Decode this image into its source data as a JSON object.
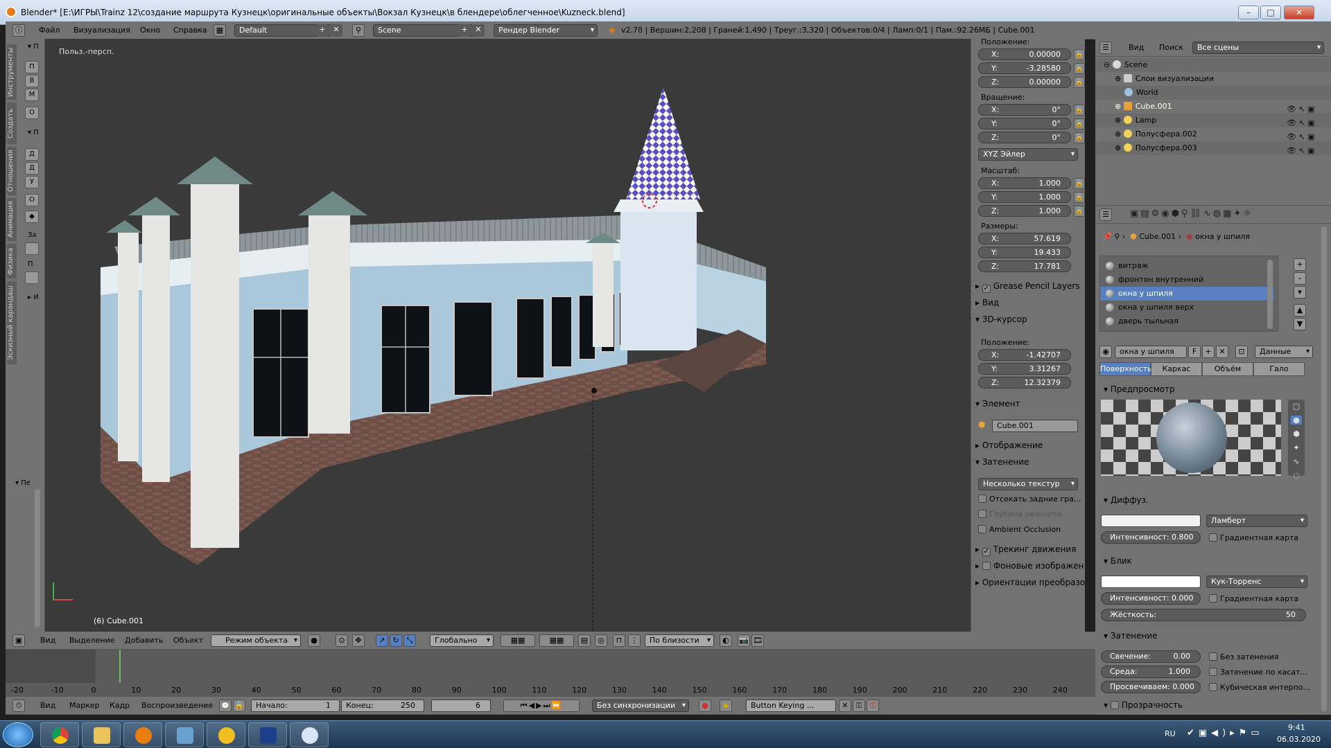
{
  "window": {
    "title": "Blender* [E:\\ИГРЫ\\Trainz 12\\создание маршрута Кузнецк\\оригинальные объекты\\Вокзал Кузнецк\\в блендере\\облегченное\\Kuzneck.blend]"
  },
  "menubar": {
    "menus": [
      "Файл",
      "Визуализация",
      "Окно",
      "Справка"
    ],
    "layout": "Default",
    "scene": "Scene",
    "engine": "Рендер Blender",
    "stats": "v2.78 | Вершин:2,208 | Граней:1,490 | Треуг.:3,320 | Объектов:0/4 | Ламп:0/1 | Пам.:92.26МБ | Cube.001"
  },
  "toolshelf": {
    "tabs": [
      "Инструменты",
      "Создать",
      "Отношения",
      "Анимация",
      "Физика",
      "Эскизный карандаш"
    ],
    "headers": [
      "▾ П",
      "▾ П",
      "▸ И",
      "▾ Пе"
    ],
    "buttons": [
      "П",
      "В",
      "М",
      "О",
      "Д",
      "Д",
      "У",
      "О",
      "За",
      "П"
    ]
  },
  "viewport": {
    "label": "Польз.-персп.",
    "object": "(6) Cube.001"
  },
  "npanel": {
    "location_label": "Положение:",
    "location": [
      {
        "axis": "X:",
        "value": "0.00000"
      },
      {
        "axis": "Y:",
        "value": "-3.28580"
      },
      {
        "axis": "Z:",
        "value": "0.00000"
      }
    ],
    "rotation_label": "Вращение:",
    "rotation": [
      {
        "axis": "X:",
        "value": "0°"
      },
      {
        "axis": "Y:",
        "value": "0°"
      },
      {
        "axis": "Z:",
        "value": "0°"
      }
    ],
    "rotation_mode": "XYZ Эйлер",
    "scale_label": "Масштаб:",
    "scale": [
      {
        "axis": "X:",
        "value": "1.000"
      },
      {
        "axis": "Y:",
        "value": "1.000"
      },
      {
        "axis": "Z:",
        "value": "1.000"
      }
    ],
    "dimensions_label": "Размеры:",
    "dimensions": [
      {
        "axis": "X:",
        "value": "57.619"
      },
      {
        "axis": "Y:",
        "value": "19.433"
      },
      {
        "axis": "Z:",
        "value": "17.781"
      }
    ],
    "grease_pencil": "Grease Pencil Layers",
    "view": "Вид",
    "cursor": "3D-курсор",
    "cursor_location_label": "Положение:",
    "cursor_location": [
      {
        "axis": "X:",
        "value": "-1.42707"
      },
      {
        "axis": "Y:",
        "value": "3.31267"
      },
      {
        "axis": "Z:",
        "value": "12.32379"
      }
    ],
    "item": "Элемент",
    "item_name": "Cube.001",
    "display": "Отображение",
    "shading": "Затенение",
    "shading_mode": "Несколько текстур",
    "backface": "Отсекать задние гра...",
    "dof": "Глубина резкости",
    "ao": "Ambient Occlusion",
    "motion_tracking": "Трекинг движения",
    "background_images": "Фоновые изображен",
    "transform_orientations": "Ориентации преобразо"
  },
  "outliner": {
    "menus": [
      "Вид",
      "Поиск"
    ],
    "filter": "Все сцены",
    "items": [
      "Scene",
      "Слои визуализации",
      "World",
      "Cube.001",
      "Lamp",
      "Полусфера.002",
      "Полусфера.003"
    ]
  },
  "properties": {
    "breadcrumb_object": "Cube.001",
    "breadcrumb_material": "окна у шпиля",
    "slots": [
      "витраж",
      "фронтон внутренний",
      "окна у шпиля",
      "окна у шпиля верх",
      "дверь тыльная"
    ],
    "material_name": "окна у шпиля",
    "material_f": "F",
    "data_dropdown": "Данные",
    "tabs": [
      "Поверхность",
      "Каркас",
      "Объём",
      "Гало"
    ],
    "preview": "Предпросмотр",
    "diffuse": "Диффуз.",
    "diffuse_shader": "Ламберт",
    "diffuse_intensity": "Интенсивност: 0.800",
    "ramp": "Градиентная карта",
    "specular": "Блик",
    "specular_shader": "Кук-Торренс",
    "specular_intensity": "Интенсивност: 0.000",
    "ramp2": "Градиентная карта",
    "hardness_label": "Жёсткость:",
    "hardness": "50",
    "shading": "Затенение",
    "emit": "Свечение:",
    "emit_val": "0.00",
    "shadeless": "Без затенения",
    "ambient": "Среда:",
    "ambient_val": "1.000",
    "tangent": "Затенение по касат...",
    "translucency": "Просвечиваем: 0.000",
    "cubic": "Кубическая интерпо...",
    "transparency": "Прозрачность"
  },
  "view_header": {
    "menus": [
      "Вид",
      "Выделение",
      "Добавить",
      "Объект"
    ],
    "mode": "Режим объекта",
    "orientation": "Глобально",
    "snap": "По близости"
  },
  "timeline": {
    "ticks": [
      "-20",
      "-10",
      "0",
      "10",
      "20",
      "30",
      "40",
      "50",
      "60",
      "70",
      "80",
      "90",
      "100",
      "110",
      "120",
      "130",
      "140",
      "150",
      "160",
      "170",
      "180",
      "190",
      "200",
      "210",
      "220",
      "230",
      "240"
    ],
    "menus": [
      "Вид",
      "Маркер",
      "Кадр",
      "Воспроизведение"
    ],
    "start": "Начало:",
    "start_val": "1",
    "end": "Конец:",
    "end_val": "250",
    "current": "6",
    "sync": "Без синхронизации",
    "keying": "Button Keying ..."
  },
  "taskbar": {
    "lang": "RU",
    "time": "9:41",
    "date": "06.03.2020"
  },
  "colors": {
    "accent": "#5680c2",
    "panel": "#727272",
    "viewport": "#3a3a3a"
  }
}
